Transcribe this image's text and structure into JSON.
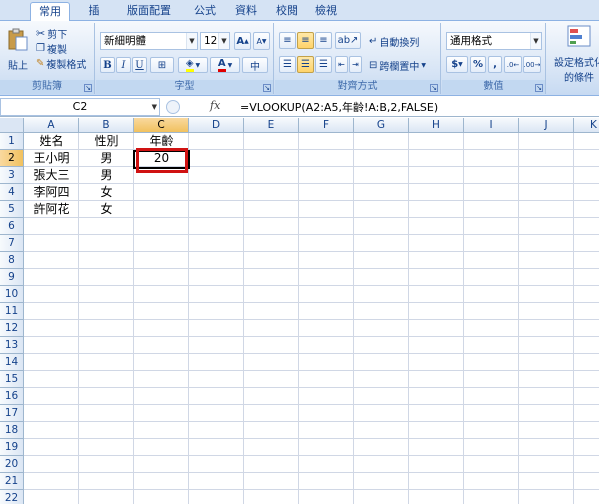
{
  "tabs": [
    {
      "label": "常用",
      "active": true
    },
    {
      "label": "插入"
    },
    {
      "label": "版面配置"
    },
    {
      "label": "公式"
    },
    {
      "label": "資料"
    },
    {
      "label": "校閱"
    },
    {
      "label": "檢視"
    }
  ],
  "ribbon": {
    "clipboard": {
      "paste": "貼上",
      "cut": "剪下",
      "copy": "複製",
      "format_painter": "複製格式",
      "label": "剪貼簿"
    },
    "font": {
      "font_name": "新細明體",
      "font_size": "12",
      "grow": "A",
      "shrink": "A",
      "bold": "B",
      "italic": "I",
      "underline": "U",
      "label": "字型"
    },
    "alignment": {
      "wrap_text": "自動換列",
      "merge_center": "跨欄置中",
      "label": "對齊方式"
    },
    "number": {
      "format": "通用格式",
      "currency": "$",
      "percent": "%",
      "comma": ",",
      "label": "數值"
    },
    "styles": {
      "conditional_formatting_line1": "設定格式化",
      "conditional_formatting_line2": "的條件"
    }
  },
  "formula_bar": {
    "name_box": "C2",
    "fx": "fx",
    "formula": "=VLOOKUP(A2:A5,年齡!A:B,2,FALSE)"
  },
  "sheet": {
    "columns": [
      "A",
      "B",
      "C",
      "D",
      "E",
      "F",
      "G",
      "H",
      "I",
      "J",
      "K"
    ],
    "rows": [
      "1",
      "2",
      "3",
      "4",
      "5",
      "6",
      "7",
      "8",
      "9",
      "10",
      "11",
      "12",
      "13",
      "14",
      "15",
      "16",
      "17",
      "18",
      "19",
      "20",
      "21",
      "22"
    ],
    "selected_cell": "C2",
    "cells": [
      {
        "ref": "A1",
        "value": "姓名"
      },
      {
        "ref": "B1",
        "value": "性別"
      },
      {
        "ref": "C1",
        "value": "年齡"
      },
      {
        "ref": "A2",
        "value": "王小明"
      },
      {
        "ref": "B2",
        "value": "男"
      },
      {
        "ref": "C2",
        "value": "20"
      },
      {
        "ref": "A3",
        "value": "張大三"
      },
      {
        "ref": "B3",
        "value": "男"
      },
      {
        "ref": "A4",
        "value": "李阿四"
      },
      {
        "ref": "B4",
        "value": "女"
      },
      {
        "ref": "A5",
        "value": "許阿花"
      },
      {
        "ref": "B5",
        "value": "女"
      }
    ]
  },
  "colors": {
    "highlight_box": "#d01212",
    "header_selected": "#f1c15f",
    "ribbon_text": "#15428b"
  }
}
